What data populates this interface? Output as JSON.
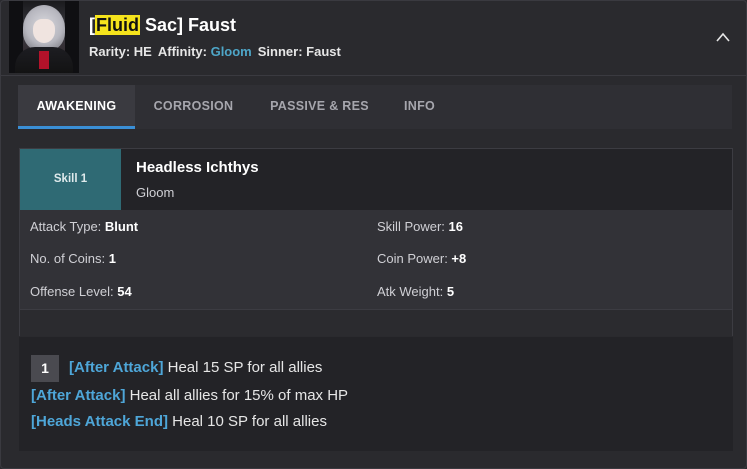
{
  "header": {
    "title_open": "[",
    "title_highlight": "Fluid",
    "title_rest": " Sac] Faust",
    "rarity_label": "Rarity: ",
    "rarity_value": "HE",
    "affinity_label": "Affinity: ",
    "affinity_value": "Gloom",
    "sinner_label": "Sinner: ",
    "sinner_value": "Faust"
  },
  "tabs": [
    {
      "label": "AWAKENING",
      "active": true
    },
    {
      "label": "CORROSION",
      "active": false
    },
    {
      "label": "PASSIVE & RES",
      "active": false
    },
    {
      "label": "INFO",
      "active": false
    }
  ],
  "skill": {
    "badge": "Skill 1",
    "name": "Headless Ichthys",
    "affinity": "Gloom",
    "stats": {
      "attack_type_label": "Attack Type: ",
      "attack_type": "Blunt",
      "skill_power_label": "Skill Power: ",
      "skill_power": "16",
      "coins_label": "No. of Coins: ",
      "coins": "1",
      "coin_power_label": "Coin Power: ",
      "coin_power": "+8",
      "offense_label": "Offense Level: ",
      "offense": "54",
      "weight_label": "Atk Weight: ",
      "weight": "5"
    }
  },
  "effects": {
    "coin_number": "1",
    "lines": [
      {
        "tag": "[After Attack]",
        "text": " Heal 15 SP for all allies"
      },
      {
        "tag": "[After Attack]",
        "text": " Heal all allies for 15% of max HP"
      },
      {
        "tag": "[Heads Attack End]",
        "text": " Heal 10 SP for all allies"
      }
    ]
  },
  "colors": {
    "accent": "#3a8fd6",
    "gloom": "#4ea6c8",
    "highlight": "#f5e31c",
    "skill_badge": "#2f6a74"
  },
  "icons": {
    "collapse": "chevron-up-icon"
  }
}
